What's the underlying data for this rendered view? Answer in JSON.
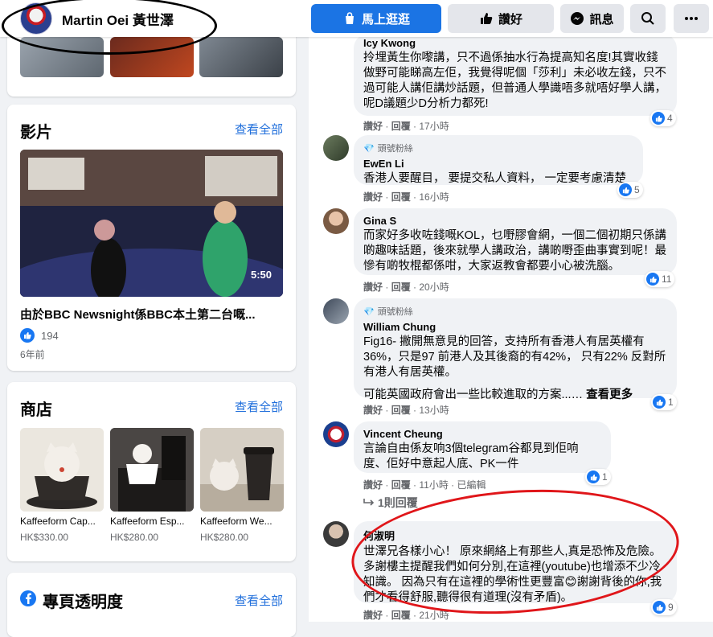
{
  "page": {
    "name": "Martin Oei 黃世澤"
  },
  "topbar": {
    "primary_label": "馬上逛逛",
    "like_label": "讚好",
    "message_label": "訊息"
  },
  "videos": {
    "heading": "影片",
    "see_all": "查看全部",
    "duration": "5:50",
    "title": "由於BBC Newsnight係BBC本土第二台嘅...",
    "likes": "194",
    "age": "6年前"
  },
  "shop": {
    "heading": "商店",
    "see_all": "查看全部",
    "items": [
      {
        "name": "Kaffeeform Cap...",
        "price": "HK$330.00"
      },
      {
        "name": "Kaffeeform Esp...",
        "price": "HK$280.00"
      },
      {
        "name": "Kaffeeform We...",
        "price": "HK$280.00"
      }
    ]
  },
  "transparency": {
    "heading": "專頁透明度",
    "see_all": "查看全部"
  },
  "comments": [
    {
      "name": "Icy Kwong",
      "text": "拎埋黃生你嚟講，只不過係抽水行為提高知名度!其實收錢做野可能睇高左佢，我覺得呢個「莎利」未必收左錢，只不過可能人講佢講炒話題，但普通人學識唔多就唔好學人講，呢D議題少D分析力都死!",
      "actions": {
        "like": "讚好",
        "reply": "回覆",
        "time": "17小時"
      },
      "reactions": "4"
    },
    {
      "badge": "頭號粉絲",
      "name": "EwEn Li",
      "text": "香港人要醒目， 要提交私人資料， 一定要考慮清楚",
      "actions": {
        "like": "讚好",
        "reply": "回覆",
        "time": "16小時"
      },
      "reactions": "5"
    },
    {
      "name": "Gina S",
      "text": "而家好多收咗錢嘅KOL，乜嘢膠會網，一個二個初期只係講啲趣味話題，後來就學人講政治，講啲嘢歪曲事實到呢！最慘有啲牧棍都係咁，大家返教會都要小心被洗腦。",
      "actions": {
        "like": "讚好",
        "reply": "回覆",
        "time": "20小時"
      },
      "reactions": "11"
    },
    {
      "badge": "頭號粉絲",
      "name": "William Chung",
      "text": "Fig16- 撇開無意見的回答，支持所有香港人有居英權有36%，只是97 前港人及其後裔的有42%， 只有22% 反對所有港人有居英權。",
      "text2": "可能英國政府會出一些比較進取的方案...…",
      "more": "查看更多",
      "actions": {
        "like": "讚好",
        "reply": "回覆",
        "time": "13小時"
      },
      "reactions": "1"
    },
    {
      "name": "Vincent Cheung",
      "text": "言論自由係友响3個telegram谷都見到佢响度、佢好中意起人底、PK一件",
      "actions": {
        "like": "讚好",
        "reply": "回覆",
        "time": "11小時",
        "edited": "已編輯"
      },
      "reactions": "1",
      "replies": "1則回覆"
    },
    {
      "name": "何淑明",
      "text": "世澤兄各樣小心！ 原來網絡上有那些人,真是恐怖及危險。多謝樓主提醒我們如何分別,在這裡(youtube)也增添不少冷知識。 因為只有在這裡的學術性更豐富😊謝謝背後的你,我們才看得舒服,聽得很有道理(沒有矛盾)。",
      "actions": {
        "like": "讚好",
        "reply": "回覆",
        "time": "21小時"
      },
      "reactions": "9"
    }
  ]
}
